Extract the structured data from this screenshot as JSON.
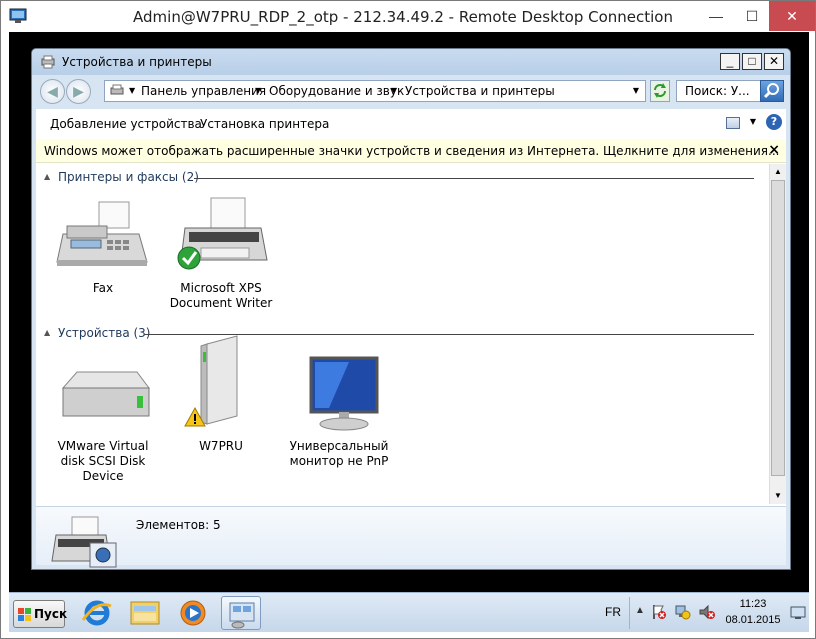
{
  "rdp_window": {
    "title": "Admin@W7PRU_RDP_2_otp - 212.34.49.2 - Remote Desktop Connection",
    "minimize_label": "—",
    "maximize_label": "☐",
    "close_label": "✕"
  },
  "explorer": {
    "title": "Устройства и принтеры",
    "minimize_label": "_",
    "maximize_label": "□",
    "close_label": "✕",
    "breadcrumb": [
      "Панель управления",
      "Оборудование и звук",
      "Устройства и принтеры"
    ],
    "search_placeholder": "Поиск: У...",
    "toolbar": {
      "add_device": "Добавление устройства",
      "add_printer": "Установка принтера"
    },
    "infobar_text": "Windows может отображать расширенные значки устройств и сведения из Интернета.  Щелкните для изменения...",
    "infobar_close": "×",
    "groups": [
      {
        "label": "Принтеры и факсы (2)",
        "items": [
          {
            "label": "Fax",
            "icon": "fax-icon"
          },
          {
            "label": "Microsoft XPS Document Writer",
            "icon": "printer-default-icon"
          }
        ]
      },
      {
        "label": "Устройства (3)",
        "items": [
          {
            "label": "VMware Virtual disk SCSI Disk Device",
            "icon": "hard-disk-icon"
          },
          {
            "label": "W7PRU",
            "icon": "computer-warning-icon"
          },
          {
            "label": "Универсальный монитор не PnP",
            "icon": "monitor-icon"
          }
        ]
      }
    ],
    "details_text": "Элементов: 5"
  },
  "taskbar": {
    "start_label": "Пуск",
    "language": "FR",
    "time": "11:23",
    "date": "08.01.2015",
    "apps": [
      "internet-explorer-icon",
      "windows-explorer-icon",
      "media-player-icon",
      "devices-printers-icon"
    ]
  }
}
